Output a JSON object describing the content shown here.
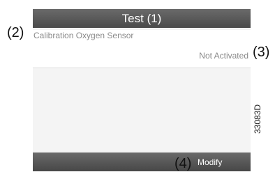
{
  "header": {
    "title": "Test",
    "callout": "(1)"
  },
  "row": {
    "label": "Calibration Oxygen Sensor",
    "value": "Not Activated",
    "label_callout": "(2)",
    "value_callout": "(3)"
  },
  "footer": {
    "modify_label": "Modify",
    "callout": "(4)"
  },
  "figure_id": "33083D"
}
